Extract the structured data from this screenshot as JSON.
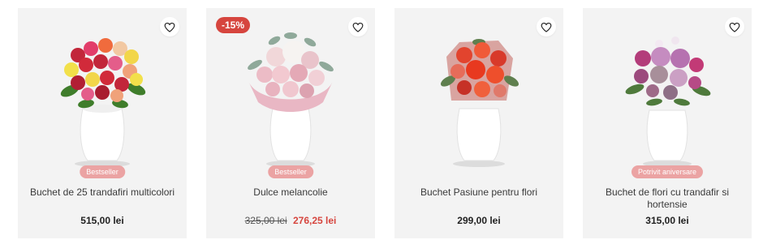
{
  "products": [
    {
      "badge": "Bestseller",
      "title": "Buchet de 25 trandafiri multicolori",
      "price": "515,00 lei"
    },
    {
      "discount": "-15%",
      "badge": "Bestseller",
      "title": "Dulce melancolie",
      "old_price": "325,00 lei",
      "new_price": "276,25 lei"
    },
    {
      "title": "Buchet Pasiune pentru flori",
      "price": "299,00 lei"
    },
    {
      "badge": "Potrivit aniversare",
      "title": "Buchet de flori cu trandafir si hortensie",
      "price": "315,00 lei"
    }
  ],
  "colors": {
    "card_bg": "#f3f3f3",
    "badge_bg": "#eba3a3",
    "sale_red": "#d6453e"
  }
}
